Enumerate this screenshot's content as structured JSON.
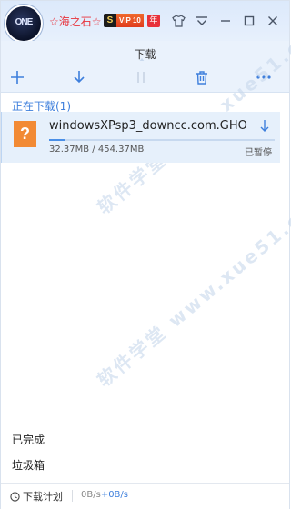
{
  "titlebar": {
    "avatar_text": "ONE",
    "username": "☆海之石☆",
    "vip_s": "S",
    "vip_label": "VIP 10",
    "year_badge": "年"
  },
  "header": {
    "tab": "下载"
  },
  "toolbar": {
    "add": "add-icon",
    "download": "download-icon",
    "pause": "pause-icon",
    "delete": "trash-icon",
    "more": "more-icon"
  },
  "downloading": {
    "title": "正在下载(1)",
    "items": [
      {
        "icon_text": "?",
        "name": "windowsXPsp3_downcc.com.GHO",
        "size": "32.37MB / 454.37MB",
        "status": "已暂停",
        "progress": 0.071
      }
    ]
  },
  "nav": {
    "completed": "已完成",
    "trash": "垃圾箱"
  },
  "statusbar": {
    "plan": "下载计划",
    "speed_down": "0B/s",
    "speed_up": "+0B/s"
  },
  "watermark": {
    "text": "软件学堂 www.xue51.com"
  },
  "colors": {
    "accent": "#3e7fdc",
    "header_bg": "#eaf2fc",
    "item_bg": "#e6f0fb",
    "file_icon": "#f28a34",
    "username": "#e8313a"
  }
}
